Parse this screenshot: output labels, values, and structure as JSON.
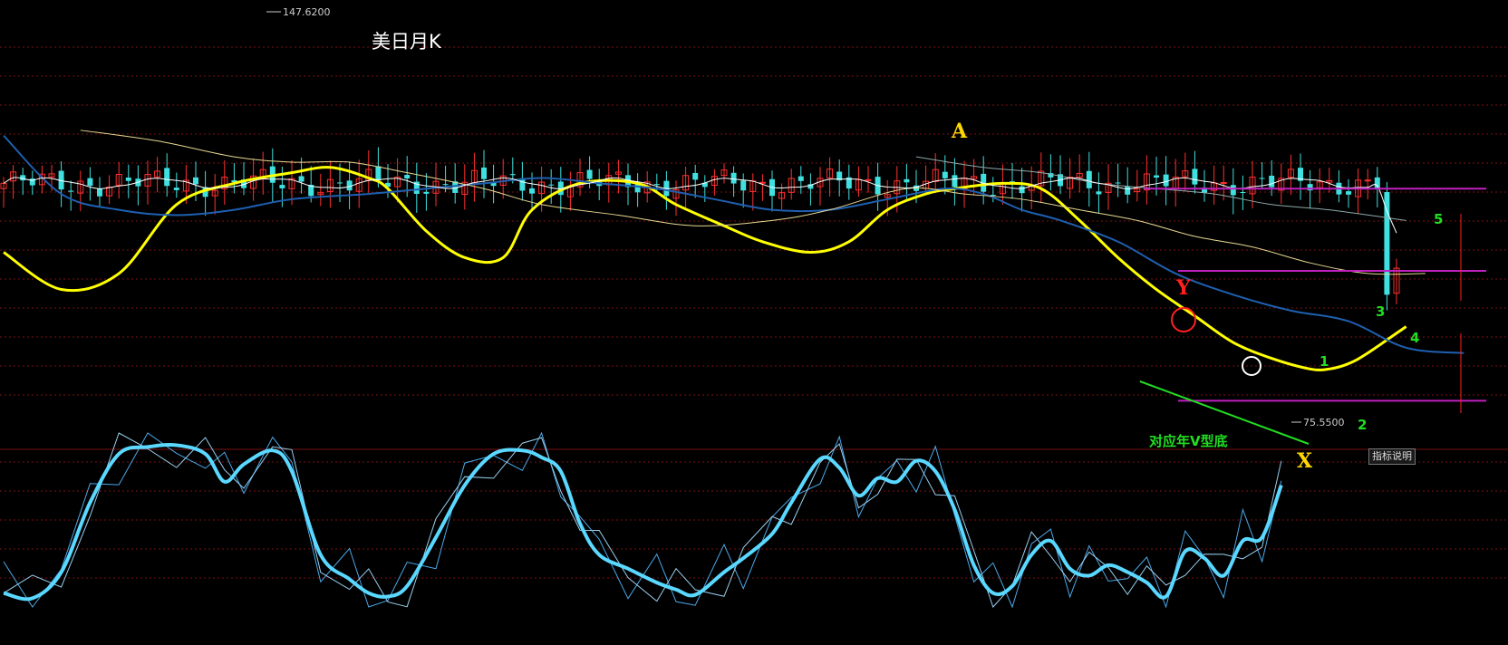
{
  "title": "美日月K",
  "indicator_button": "指标说明",
  "colors": {
    "background": "#000000",
    "grid": "#7a1010",
    "up": "#ff3030",
    "down": "#40e0e0",
    "ma_thick": "#ffff00",
    "ma_blue": "#1f5fb0",
    "ma_pale": "#e8d890",
    "ma_white": "#ffffff",
    "annot_yellow": "#ffd700",
    "annot_red": "#ff2020",
    "annot_green": "#22dd22",
    "annot_magenta": "#c020c0",
    "kdj_main": "#5ad8ff",
    "kdj_thin": "#4aa8e8"
  },
  "chart_data": [
    {
      "type": "candlestick",
      "title": "美日月K",
      "y_range": [
        73,
        149
      ],
      "annotations": {
        "max_price_label": "147.6200",
        "min_price_label": "75.5500",
        "points": [
          "A",
          "Y",
          "X"
        ],
        "waves": [
          "1",
          "2",
          "3",
          "4",
          "5"
        ],
        "text": "对应年V型底"
      },
      "anchors": [
        [
          147,
          101
        ],
        [
          143,
          112
        ],
        [
          139,
          98
        ],
        [
          135,
          92
        ],
        [
          131,
          88
        ],
        [
          129,
          100
        ],
        [
          127,
          104
        ],
        [
          123,
          108
        ],
        [
          119,
          117
        ],
        [
          115,
          121
        ],
        [
          111,
          124
        ],
        [
          107,
          129
        ],
        [
          103,
          132
        ],
        [
          99,
          124
        ],
        [
          95,
          123
        ],
        [
          91,
          118
        ],
        [
          87,
          117
        ],
        [
          83,
          114
        ],
        [
          79,
          110
        ],
        [
          75,
          104
        ],
        [
          73,
          101
        ],
        [
          71,
          106
        ],
        [
          69,
          110
        ],
        [
          67,
          112
        ],
        [
          65,
          113
        ],
        [
          63,
          121
        ],
        [
          61,
          122
        ],
        [
          59,
          127
        ],
        [
          57,
          116
        ],
        [
          55,
          110
        ],
        [
          53,
          108
        ],
        [
          49,
          118
        ],
        [
          47,
          112
        ],
        [
          45,
          110
        ],
        [
          43,
          108
        ],
        [
          41,
          103
        ],
        [
          40,
          101
        ],
        [
          38,
          99
        ],
        [
          36,
          105
        ],
        [
          34,
          110
        ],
        [
          32,
          116
        ],
        [
          30,
          118
        ],
        [
          28,
          116
        ],
        [
          26,
          116
        ],
        [
          25,
          117
        ],
        [
          24,
          115
        ],
        [
          22,
          112
        ],
        [
          20,
          106
        ],
        [
          18,
          103
        ],
        [
          16,
          99
        ],
        [
          14,
          97
        ],
        [
          12,
          96
        ],
        [
          10,
          93
        ],
        [
          8,
          91
        ],
        [
          7,
          94
        ],
        [
          6,
          99
        ],
        [
          5,
          107
        ],
        [
          4,
          111
        ],
        [
          3,
          113
        ],
        [
          1,
          117
        ]
      ],
      "ma_series": [
        {
          "color": "#ffff00",
          "width": 3,
          "values": [
            [
              0,
              104
            ],
            [
              6,
              97
            ],
            [
              12,
              100
            ],
            [
              18,
              113
            ],
            [
              24,
              117
            ],
            [
              30,
              119
            ],
            [
              34,
              120
            ],
            [
              38,
              118
            ],
            [
              40,
              116
            ],
            [
              44,
              108
            ],
            [
              48,
              103
            ],
            [
              52,
              103
            ],
            [
              55,
              112
            ],
            [
              60,
              117
            ],
            [
              66,
              117
            ],
            [
              70,
              113
            ],
            [
              75,
              109
            ],
            [
              79,
              106
            ],
            [
              84,
              104
            ],
            [
              88,
              106
            ],
            [
              92,
              112
            ],
            [
              96,
              115
            ],
            [
              99,
              116
            ],
            [
              104,
              117
            ],
            [
              108,
              116
            ],
            [
              112,
              110
            ],
            [
              116,
              103
            ],
            [
              120,
              97
            ],
            [
              124,
              92
            ],
            [
              128,
              87
            ],
            [
              132,
              84
            ],
            [
              136,
              82
            ],
            [
              138,
              82
            ],
            [
              140,
              83
            ],
            [
              142,
              85
            ],
            [
              146,
              90
            ]
          ]
        },
        {
          "color": "#1f5fb0",
          "width": 2,
          "values": [
            [
              0,
              126
            ],
            [
              6,
              115
            ],
            [
              12,
              112
            ],
            [
              18,
              111
            ],
            [
              24,
              112
            ],
            [
              30,
              114
            ],
            [
              38,
              115
            ],
            [
              44,
              116
            ],
            [
              50,
              117
            ],
            [
              56,
              118
            ],
            [
              62,
              117
            ],
            [
              68,
              116
            ],
            [
              74,
              114
            ],
            [
              80,
              112
            ],
            [
              86,
              112
            ],
            [
              92,
              114
            ],
            [
              98,
              116
            ],
            [
              102,
              115
            ],
            [
              106,
              112
            ],
            [
              110,
              110
            ],
            [
              116,
              106
            ],
            [
              122,
              100
            ],
            [
              128,
              96
            ],
            [
              134,
              93
            ],
            [
              140,
              91
            ],
            [
              146,
              86
            ],
            [
              152,
              85
            ]
          ]
        },
        {
          "color": "#e8d890",
          "width": 1,
          "values": [
            [
              8,
              127
            ],
            [
              16,
              125
            ],
            [
              24,
              122
            ],
            [
              30,
              121
            ],
            [
              36,
              121
            ],
            [
              42,
              119
            ],
            [
              50,
              116
            ],
            [
              56,
              113
            ],
            [
              64,
              111
            ],
            [
              72,
              109
            ],
            [
              80,
              110
            ],
            [
              86,
              112
            ],
            [
              94,
              116
            ],
            [
              100,
              115
            ],
            [
              106,
              114
            ],
            [
              112,
              112
            ],
            [
              118,
              110
            ],
            [
              124,
              107
            ],
            [
              130,
              105
            ],
            [
              136,
              102
            ],
            [
              142,
              100
            ],
            [
              148,
              100
            ]
          ]
        },
        {
          "color": "#8fa8a8",
          "width": 1,
          "values": [
            [
              95,
              122
            ],
            [
              102,
              120
            ],
            [
              108,
              119
            ],
            [
              114,
              117
            ],
            [
              120,
              116
            ],
            [
              126,
              115
            ],
            [
              132,
              113
            ],
            [
              138,
              112
            ],
            [
              146,
              110
            ]
          ]
        }
      ],
      "wave_levels": [
        116,
        100.5,
        76
      ],
      "note": "Monthly USD/JPY-style candles; values estimated from the image."
    },
    {
      "type": "line",
      "title": "",
      "y_range": [
        0,
        100
      ],
      "series": [
        {
          "color": "#5ad8ff",
          "width": 4,
          "values": [
            [
              0,
              8
            ],
            [
              3,
              5
            ],
            [
              6,
              20
            ],
            [
              9,
              60
            ],
            [
              12,
              88
            ],
            [
              15,
              92
            ],
            [
              18,
              93
            ],
            [
              21,
              88
            ],
            [
              23,
              72
            ],
            [
              25,
              82
            ],
            [
              28,
              90
            ],
            [
              30,
              78
            ],
            [
              33,
              30
            ],
            [
              36,
              16
            ],
            [
              38,
              8
            ],
            [
              40,
              6
            ],
            [
              42,
              12
            ],
            [
              45,
              40
            ],
            [
              48,
              70
            ],
            [
              51,
              88
            ],
            [
              54,
              90
            ],
            [
              56,
              86
            ],
            [
              58,
              78
            ],
            [
              60,
              48
            ],
            [
              62,
              30
            ],
            [
              65,
              22
            ],
            [
              68,
              14
            ],
            [
              70,
              10
            ],
            [
              72,
              7
            ],
            [
              75,
              20
            ],
            [
              77,
              28
            ],
            [
              80,
              42
            ],
            [
              82,
              60
            ],
            [
              85,
              85
            ],
            [
              87,
              80
            ],
            [
              89,
              64
            ],
            [
              91,
              74
            ],
            [
              93,
              72
            ],
            [
              95,
              84
            ],
            [
              97,
              78
            ],
            [
              99,
              56
            ],
            [
              101,
              24
            ],
            [
              103,
              8
            ],
            [
              105,
              12
            ],
            [
              107,
              30
            ],
            [
              109,
              38
            ],
            [
              111,
              22
            ],
            [
              113,
              18
            ],
            [
              115,
              24
            ],
            [
              117,
              20
            ],
            [
              119,
              14
            ],
            [
              121,
              6
            ],
            [
              123,
              32
            ],
            [
              125,
              28
            ],
            [
              127,
              18
            ],
            [
              129,
              38
            ],
            [
              131,
              40
            ],
            [
              133,
              70
            ]
          ]
        }
      ]
    }
  ]
}
